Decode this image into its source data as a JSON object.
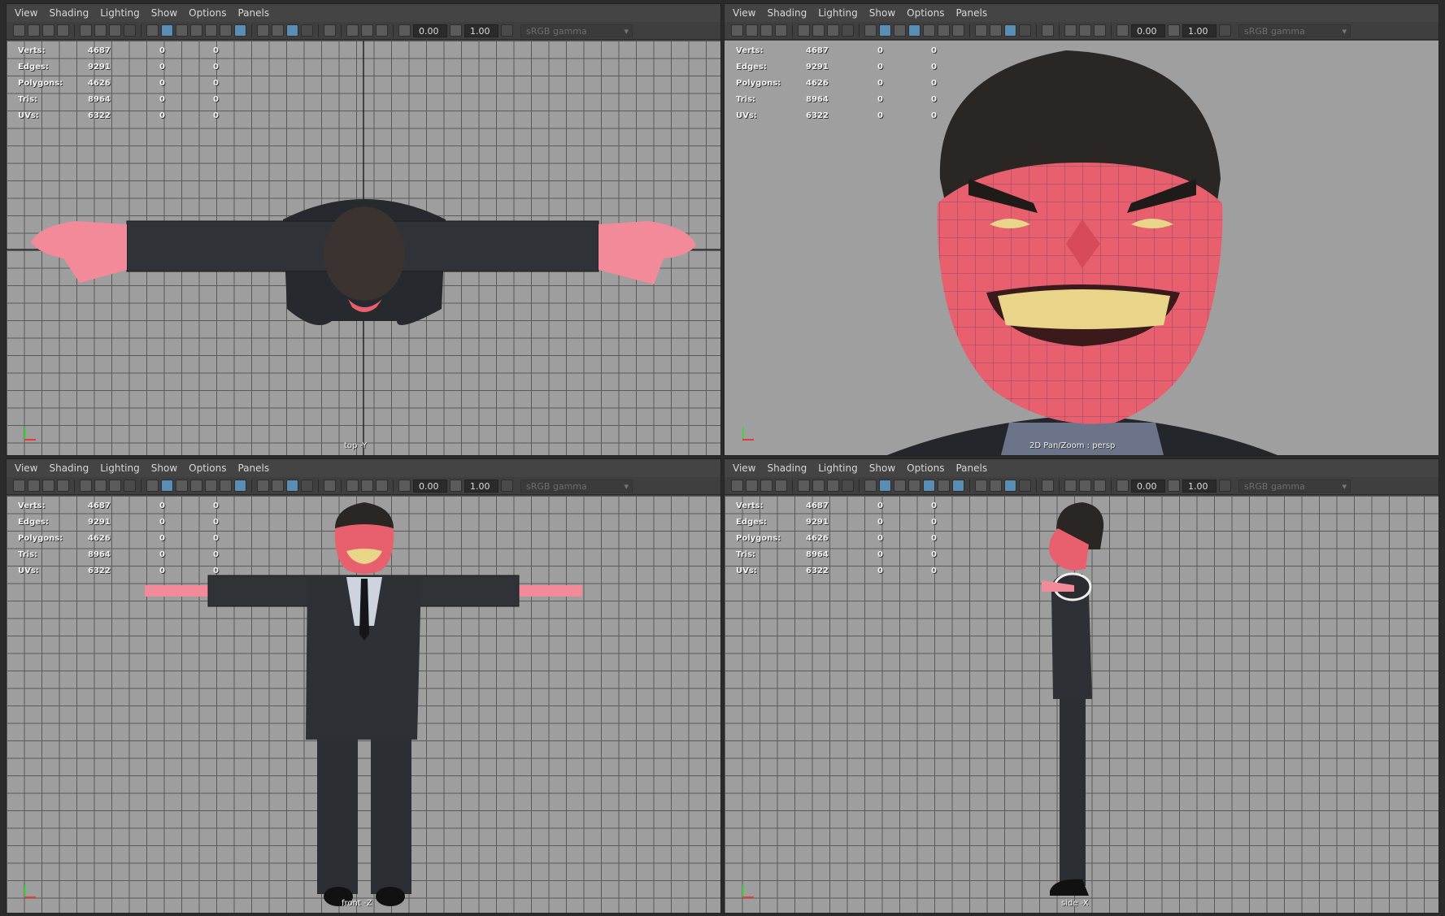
{
  "menu": [
    "View",
    "Shading",
    "Lighting",
    "Show",
    "Options",
    "Panels"
  ],
  "toolbar": {
    "field_a": "0.00",
    "field_b": "1.00",
    "color_mgmt": "sRGB gamma"
  },
  "stats": [
    {
      "label": "Verts:",
      "v1": "4687",
      "v2": "0",
      "v3": "0"
    },
    {
      "label": "Edges:",
      "v1": "9291",
      "v2": "0",
      "v3": "0"
    },
    {
      "label": "Polygons:",
      "v1": "4626",
      "v2": "0",
      "v3": "0"
    },
    {
      "label": "Tris:",
      "v1": "8964",
      "v2": "0",
      "v3": "0"
    },
    {
      "label": "UVs:",
      "v1": "6322",
      "v2": "0",
      "v3": "0"
    }
  ],
  "panels": {
    "top": {
      "camera": "top -Y"
    },
    "persp": {
      "camera": "2D Pan/Zoom : persp"
    },
    "front": {
      "camera": "front -Z"
    },
    "side": {
      "camera": "side -X"
    }
  },
  "colors": {
    "skin": "#e8606e",
    "suit": "#2d3034",
    "hair": "#2a2623",
    "teeth": "#e9d58a",
    "accent": "#5a8db3"
  },
  "icons": [
    "camera-icon",
    "grid-icon",
    "wireframe-icon",
    "smooth-shade-icon",
    "texture-icon",
    "light-icon",
    "shadow-icon",
    "xray-icon",
    "isolate-icon",
    "exposure-icon",
    "gamma-icon"
  ]
}
